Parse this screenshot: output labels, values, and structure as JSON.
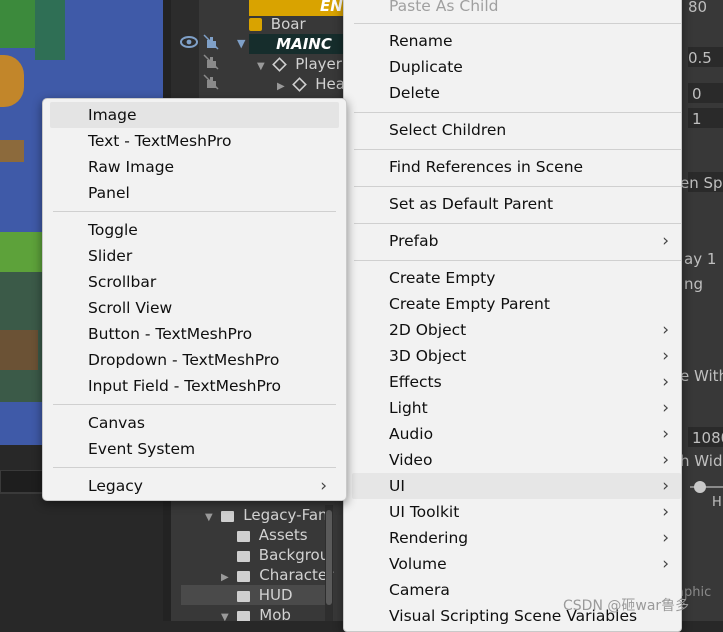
{
  "hierarchy": {
    "rows": [
      {
        "label": "ENE",
        "kind": "enemy"
      },
      {
        "label": "Boar",
        "kind": "cube"
      },
      {
        "label": "MAINC",
        "kind": "mainc"
      },
      {
        "label": "PlayerS",
        "kind": "cube"
      },
      {
        "label": "Healt",
        "kind": "cube"
      }
    ],
    "folders": [
      {
        "label": "Legacy-Fan"
      },
      {
        "label": "Assets"
      },
      {
        "label": "Backgrou"
      },
      {
        "label": "Character"
      },
      {
        "label": "HUD"
      },
      {
        "label": "Mob"
      }
    ]
  },
  "inspector": {
    "texts": [
      "80",
      "0.5",
      "0",
      "1",
      "en Sp",
      "ay 1",
      "ng",
      "e With",
      "1080",
      "h Wid",
      "H",
      "aphic"
    ]
  },
  "main_menu": {
    "items": [
      {
        "label": "Paste As Child",
        "disabled": true
      },
      {
        "label": "Rename"
      },
      {
        "label": "Duplicate"
      },
      {
        "label": "Delete"
      },
      {
        "label": "Select Children"
      },
      {
        "label": "Find References in Scene"
      },
      {
        "label": "Set as Default Parent"
      },
      {
        "label": "Prefab",
        "submenu": true
      },
      {
        "label": "Create Empty"
      },
      {
        "label": "Create Empty Parent"
      },
      {
        "label": "2D Object",
        "submenu": true
      },
      {
        "label": "3D Object",
        "submenu": true
      },
      {
        "label": "Effects",
        "submenu": true
      },
      {
        "label": "Light",
        "submenu": true
      },
      {
        "label": "Audio",
        "submenu": true
      },
      {
        "label": "Video",
        "submenu": true
      },
      {
        "label": "UI",
        "submenu": true,
        "highlighted": true
      },
      {
        "label": "UI Toolkit",
        "submenu": true
      },
      {
        "label": "Rendering",
        "submenu": true
      },
      {
        "label": "Volume",
        "submenu": true
      },
      {
        "label": "Camera"
      },
      {
        "label": "Visual Scripting Scene Variables"
      }
    ]
  },
  "ui_submenu": {
    "items": [
      {
        "label": "Image",
        "highlighted": true
      },
      {
        "label": "Text - TextMeshPro"
      },
      {
        "label": "Raw Image"
      },
      {
        "label": "Panel"
      },
      {
        "label": "Toggle"
      },
      {
        "label": "Slider"
      },
      {
        "label": "Scrollbar"
      },
      {
        "label": "Scroll View"
      },
      {
        "label": "Button - TextMeshPro"
      },
      {
        "label": "Dropdown - TextMeshPro"
      },
      {
        "label": "Input Field - TextMeshPro"
      },
      {
        "label": "Canvas"
      },
      {
        "label": "Event System"
      },
      {
        "label": "Legacy",
        "submenu": true
      }
    ]
  },
  "icons": {
    "submenu_arrow": "chevron-right-icon",
    "visibility": "eye-icon",
    "pickable": "hand-icon",
    "game_object": "cube-icon",
    "folder": "folder-icon"
  },
  "watermark": "CSDN @砸war鲁多"
}
